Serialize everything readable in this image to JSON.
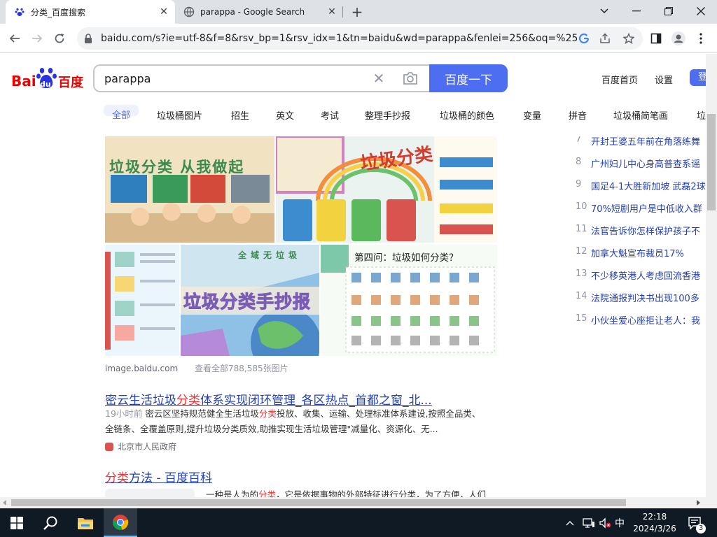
{
  "browser": {
    "tabs": [
      {
        "title": "分类_百度搜索",
        "active": true,
        "favicon": "baidu-paw-icon"
      },
      {
        "title": "parappa - Google Search",
        "active": false,
        "favicon": "google-g-icon"
      }
    ],
    "new_tab_symbol": "+",
    "url": "baidu.com/s?ie=utf-8&f=8&rsv_bp=1&rsv_idx=1&tn=baidu&wd=parappa&fenlei=256&oq=%25..."
  },
  "baidu": {
    "logo_text_1": "Bai",
    "logo_text_2": "du",
    "logo_text_3": "百度",
    "search_query": "parappa",
    "search_button": "百度一下",
    "header_links": [
      "百度首页",
      "设置"
    ],
    "login": "登",
    "related_tabs": [
      "全部",
      "垃圾桶图片",
      "招生",
      "英文",
      "考试",
      "整理手抄报",
      "垃圾桶的颜色",
      "变量",
      "拼音",
      "垃圾桶简笔画",
      "垃"
    ]
  },
  "images": {
    "tile_texts": [
      "垃圾分类 从我做起",
      "垃圾分类",
      "垃圾分类手抄报",
      "全域无垃圾",
      "第四问：垃圾如何分类？"
    ],
    "source": "image.baidu.com",
    "count_text": "查看全部788,585张图片"
  },
  "results": [
    {
      "title_pre": "密云生活垃圾",
      "title_em": "分类",
      "title_post": "体系实现闭环管理_各区热点_首都之窗_北...",
      "time": "19小时前",
      "abstract_1_pre": "密云区坚持规范健全生活垃圾",
      "abstract_1_em": "分类",
      "abstract_1_post": "投放、收集、运输、处理标准体系建设,按照全品类、",
      "abstract_2": "全链条、全覆盖原则,提升垃圾分类质效,助推实现生活垃圾管理\"减量化、资源化、无...",
      "source": "北京市人民政府"
    },
    {
      "title_em": "分类",
      "title_post": "方法 - 百度百科",
      "abstract_pre": "一种是人为的",
      "abstract_em": "分类",
      "abstract_post": "，它是依据事物的外部特征进行分类，为了方便，人们"
    }
  ],
  "hot_list": [
    {
      "num": "7",
      "text": "开封王婆五年前在角落练舞"
    },
    {
      "num": "8",
      "text": "广州妇儿中心身高普查系谣"
    },
    {
      "num": "9",
      "text": "国足4-1大胜新加坡 武磊2球"
    },
    {
      "num": "10",
      "text": "70%短剧用户是中低收入群"
    },
    {
      "num": "11",
      "text": "法官告诉你怎样保护孩子不"
    },
    {
      "num": "12",
      "text": "加拿大魁宣布裁员17%"
    },
    {
      "num": "13",
      "text": "不少移英港人考虑回流香港"
    },
    {
      "num": "14",
      "text": "法院通报判决书出现100多"
    },
    {
      "num": "15",
      "text": "小伙坐爱心座拒让老人：我"
    }
  ],
  "taskbar": {
    "ime": "中",
    "time": "22:18",
    "date": "2024/3/26",
    "notifications": "3"
  },
  "colors": {
    "baidu_blue": "#4e6ef2",
    "link_blue": "#2440b3",
    "highlight_red": "#f73131",
    "taskbar_bg": "#101a24"
  }
}
